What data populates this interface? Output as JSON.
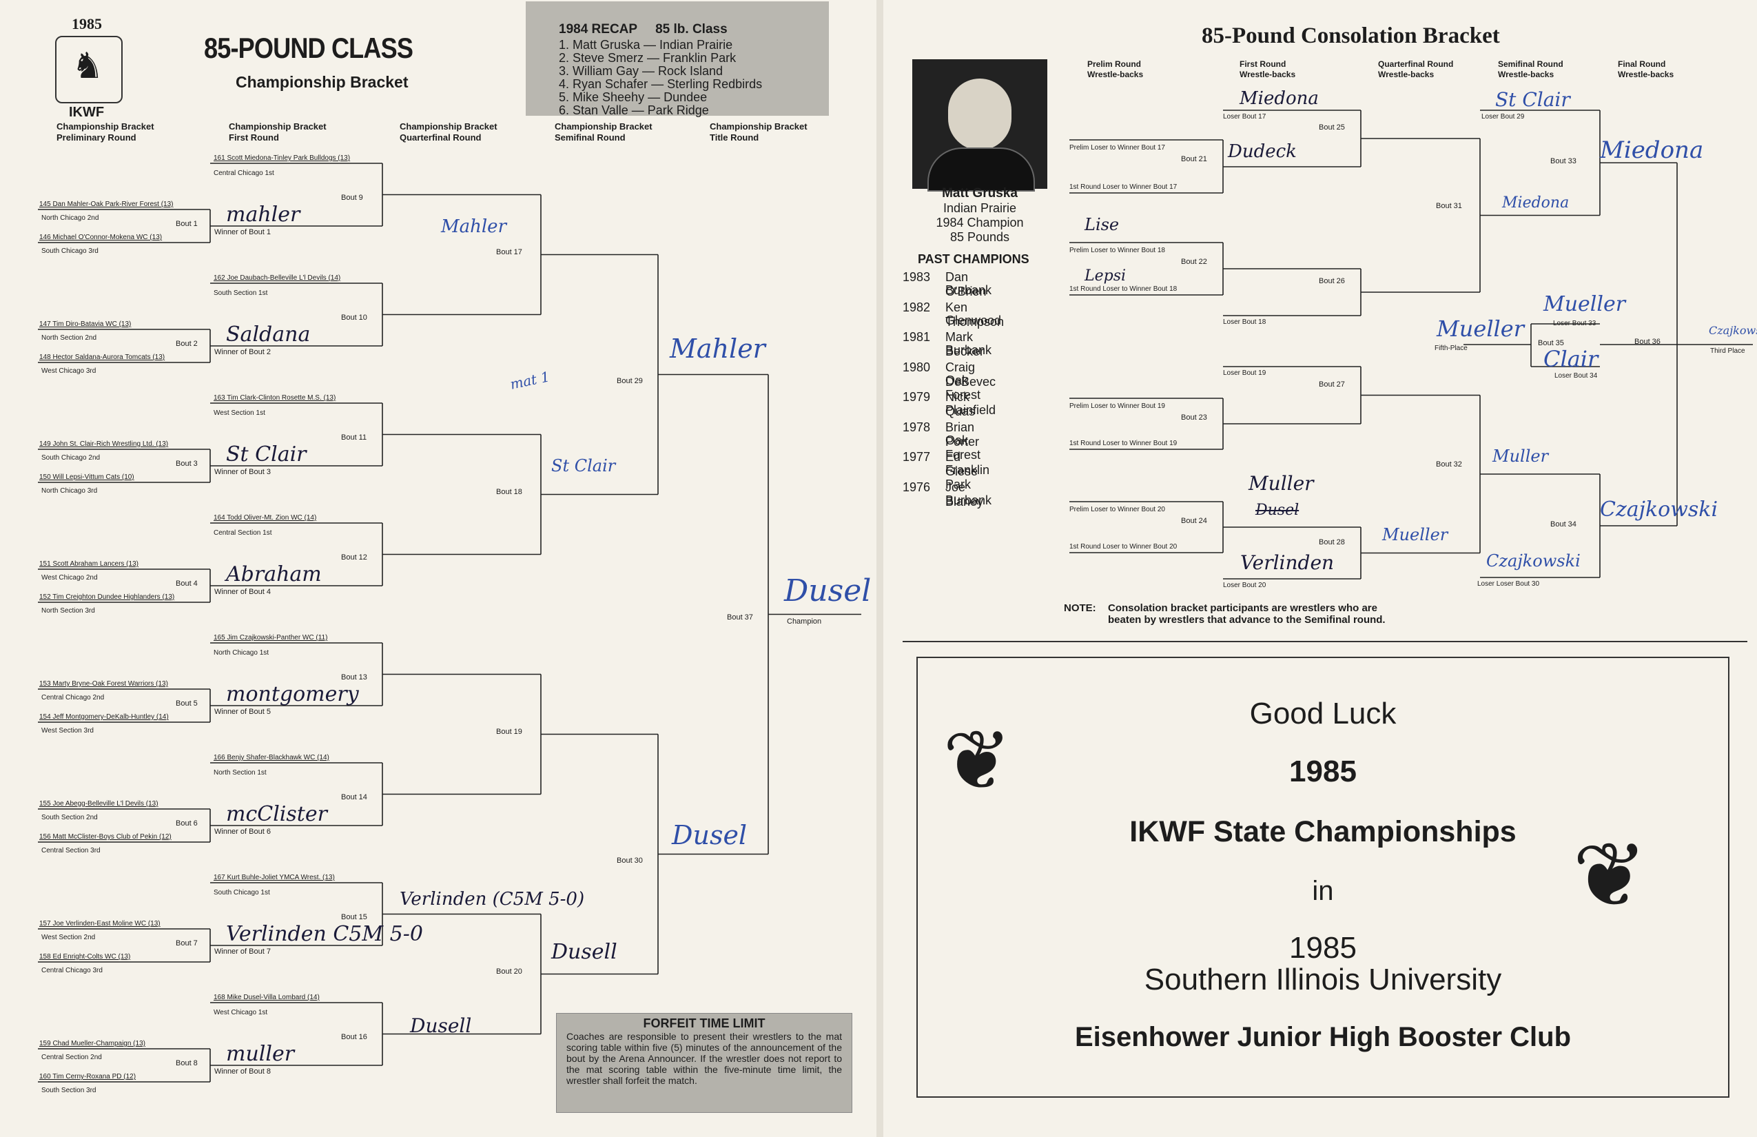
{
  "left": {
    "year": "1985",
    "org": "IKWF",
    "title": "85-POUND CLASS",
    "subtitle": "Championship Bracket",
    "col_heads": [
      "Championship Bracket\nPreliminary Round",
      "Championship Bracket\nFirst Round",
      "Championship Bracket\nQuarterfinal Round",
      "Championship Bracket\nSemifinal Round",
      "Championship Bracket\nTitle Round"
    ],
    "recap": {
      "heading": "1984 RECAP     85 lb. Class",
      "lines": [
        "1.  Matt Gruska — Indian Prairie",
        "2.  Steve Smerz — Franklin Park",
        "3.  William Gay — Rock Island",
        "4.  Ryan Schafer — Sterling Redbirds",
        "5.  Mike Sheehy — Dundee",
        "6.  Stan Valle — Park Ridge"
      ]
    },
    "prelim": [
      {
        "a": "145 Dan Mahler-Oak Park-River Forest (13)",
        "a_sec": "North Chicago 2nd",
        "b": "146 Michael O'Connor-Mokena WC (13)",
        "b_sec": "South Chicago 3rd",
        "bout": "Bout 1",
        "winner": "Winner of Bout 1",
        "hand": "mahler"
      },
      {
        "a": "147 Tim Diro-Batavia WC (13)",
        "a_sec": "North Section 2nd",
        "b": "148 Hector Saldana-Aurora Tomcats (13)",
        "b_sec": "West Chicago 3rd",
        "bout": "Bout 2",
        "winner": "Winner of Bout 2",
        "hand": "Saldana"
      },
      {
        "a": "149 John St. Clair-Rich Wrestling Ltd. (13)",
        "a_sec": "South Chicago 2nd",
        "b": "150 Will Lepsi-Vittum Cats (10)",
        "b_sec": "North Chicago 3rd",
        "bout": "Bout 3",
        "winner": "Winner of Bout 3",
        "hand": "St Clair"
      },
      {
        "a": "151 Scott Abraham Lancers (13)",
        "a_sec": "West Chicago 2nd",
        "b": "152 Tim Creighton Dundee Highlanders (13)",
        "b_sec": "North Section 3rd",
        "bout": "Bout 4",
        "winner": "Winner of Bout 4",
        "hand": "Abraham"
      },
      {
        "a": "153 Marty Bryne-Oak Forest Warriors (13)",
        "a_sec": "Central Chicago 2nd",
        "b": "154 Jeff Montgomery-DeKalb-Huntley (14)",
        "b_sec": "West Section 3rd",
        "bout": "Bout 5",
        "winner": "Winner of Bout 5",
        "hand": "montgomery"
      },
      {
        "a": "155 Joe Abegg-Belleville L'l Devils (13)",
        "a_sec": "South Section 2nd",
        "b": "156 Matt McClister-Boys Club of Pekin (12)",
        "b_sec": "Central Section 3rd",
        "bout": "Bout 6",
        "winner": "Winner of Bout 6",
        "hand": "mcClister"
      },
      {
        "a": "157 Joe Verlinden-East Moline WC (13)",
        "a_sec": "West Section 2nd",
        "b": "158 Ed Enright-Colts WC (13)",
        "b_sec": "Central Chicago 3rd",
        "bout": "Bout 7",
        "winner": "Winner of Bout 7",
        "hand": "Verlinden C5M 5-0"
      },
      {
        "a": "159 Chad Mueller-Champaign (13)",
        "a_sec": "Central Section 2nd",
        "b": "160 Tim Cerny-Roxana PD (12)",
        "b_sec": "South Section 3rd",
        "bout": "Bout 8",
        "winner": "Winner of Bout 8",
        "hand": "muller"
      }
    ],
    "first": [
      {
        "seed": "161 Scott Miedona-Tinley Park Bulldogs (13)",
        "sec": "Central Chicago 1st",
        "bout": "Bout 9"
      },
      {
        "seed": "162 Joe Daubach-Belleville L'l Devils (14)",
        "sec": "South Section 1st",
        "bout": "Bout 10"
      },
      {
        "seed": "163 Tim Clark-Clinton Rosette M.S. (13)",
        "sec": "West Section 1st",
        "bout": "Bout 11"
      },
      {
        "seed": "164 Todd Oliver-Mt. Zion WC (14)",
        "sec": "Central Section 1st",
        "bout": "Bout 12"
      },
      {
        "seed": "165 Jim Czajkowski-Panther WC (11)",
        "sec": "North Chicago 1st",
        "bout": "Bout 13"
      },
      {
        "seed": "166 Benjy Shafer-Blackhawk WC (14)",
        "sec": "North Section 1st",
        "bout": "Bout 14"
      },
      {
        "seed": "167 Kurt Buhle-Joliet YMCA Wrest. (13)",
        "sec": "South Chicago 1st",
        "bout": "Bout 15"
      },
      {
        "seed": "168 Mike Dusel-Villa Lombard (14)",
        "sec": "West Chicago 1st",
        "bout": "Bout 16"
      }
    ],
    "quarter": [
      "Bout 17",
      "Bout 18",
      "Bout 19",
      "Bout 20"
    ],
    "semi": [
      "Bout 29",
      "Bout 30"
    ],
    "final": "Bout 37",
    "champion_label": "Champion",
    "hand": {
      "q1": "Mahler",
      "q2": "St Clair",
      "q3": "",
      "q4": "Dusell",
      "f15": "Verlinden (C5M 5-0)",
      "f16": "Dusell",
      "s1": "Mahler",
      "s2": "Dusel",
      "champ": "Dusel",
      "note_mat": "mat 1"
    },
    "forfeit": {
      "title": "FORFEIT TIME LIMIT",
      "body": "Coaches are responsible to present their wrestlers to the mat scoring table within five (5) minutes of the announcement of the bout by the Arena Announcer. If the wrestler does not report to the mat scoring table within the five-minute time limit, the wrestler shall forfeit the match."
    }
  },
  "right": {
    "title": "85-Pound Consolation Bracket",
    "champ_name": "Matt Gruska",
    "champ_school": "Indian Prairie",
    "champ_year": "1984 Champion",
    "champ_weight": "85 Pounds",
    "past_heading": "PAST CHAMPIONS",
    "past": [
      {
        "year": "1983",
        "name": "Dan O'Brien",
        "town": "Burbank"
      },
      {
        "year": "1982",
        "name": "Ken Thompson",
        "town": "Glenwood"
      },
      {
        "year": "1981",
        "name": "Mark Becker",
        "town": "Burbank"
      },
      {
        "year": "1980",
        "name": "Craig DeBevec",
        "town": "Oak Forest"
      },
      {
        "year": "1979",
        "name": "Nick Quas",
        "town": "Plainfield"
      },
      {
        "year": "1978",
        "name": "Brian Porter",
        "town": "Oak Forest"
      },
      {
        "year": "1977",
        "name": "Ed Giese",
        "town": "Franklin Park"
      },
      {
        "year": "1976",
        "name": "Joe Blaney",
        "town": "Burbank"
      }
    ],
    "col_heads": [
      "Prelim Round\nWrestle-backs",
      "First Round\nWrestle-backs",
      "Quarterfinal Round\nWrestle-backs",
      "Semifinal Round\nWrestle-backs",
      "Final Round\nWrestle-backs"
    ],
    "labels": {
      "p17": "Prelim Loser to Winner Bout 17",
      "r17": "1st Round Loser to Winner Bout 17",
      "p18": "Prelim Loser to Winner Bout 18",
      "r18": "1st Round Loser to Winner Bout 18",
      "p19": "Prelim Loser to Winner Bout 19",
      "r19": "1st Round Loser to Winner Bout 19",
      "p20": "Prelim Loser to Winner Bout 20",
      "r20": "1st Round Loser to Winner Bout 20",
      "lb17": "Loser Bout 17",
      "lb18": "Loser Bout 18",
      "lb19": "Loser Bout 19",
      "lb20": "Loser Bout 20",
      "lb29": "Loser Bout 29",
      "lb30": "Loser Loser Bout 30",
      "lb33": "Loser Bout 33",
      "lb34": "Loser Bout 34",
      "b21": "Bout 21",
      "b22": "Bout 22",
      "b23": "Bout 23",
      "b24": "Bout 24",
      "b25": "Bout 25",
      "b26": "Bout 26",
      "b27": "Bout 27",
      "b28": "Bout 28",
      "b31": "Bout 31",
      "b32": "Bout 32",
      "b33": "Bout 33",
      "b34": "Bout 34",
      "b35": "Bout 35",
      "b36": "Bout 36",
      "fifth": "Fifth-Place",
      "third": "Third Place"
    },
    "hand": {
      "c17": "Miedona",
      "w25": "Dudeck",
      "p18": "Lise",
      "w22": "Lepsi",
      "w27": "Muller",
      "w27b": "Dusel",
      "w28": "Verlinden",
      "c29": "St Clair",
      "w31": "Miedona",
      "w33": "Miedona",
      "w32": "Muller",
      "w32b": "Mueller",
      "c30": "Czajkowski",
      "w34": "Czajkowski",
      "m1": "Mueller",
      "m2": "Mueller",
      "w35": "Clair",
      "w36": "Czajkowski"
    },
    "note_label": "NOTE:",
    "note_text": "Consolation bracket participants are wrestlers who are beaten by wrestlers that advance to the Semifinal round.",
    "ad": {
      "l1": "Good Luck",
      "l2": "1985",
      "l3": "IKWF State Championships",
      "l4": "in",
      "l5": "1985",
      "l6": "Southern Illinois University",
      "l7": "Eisenhower Junior High Booster Club"
    }
  }
}
